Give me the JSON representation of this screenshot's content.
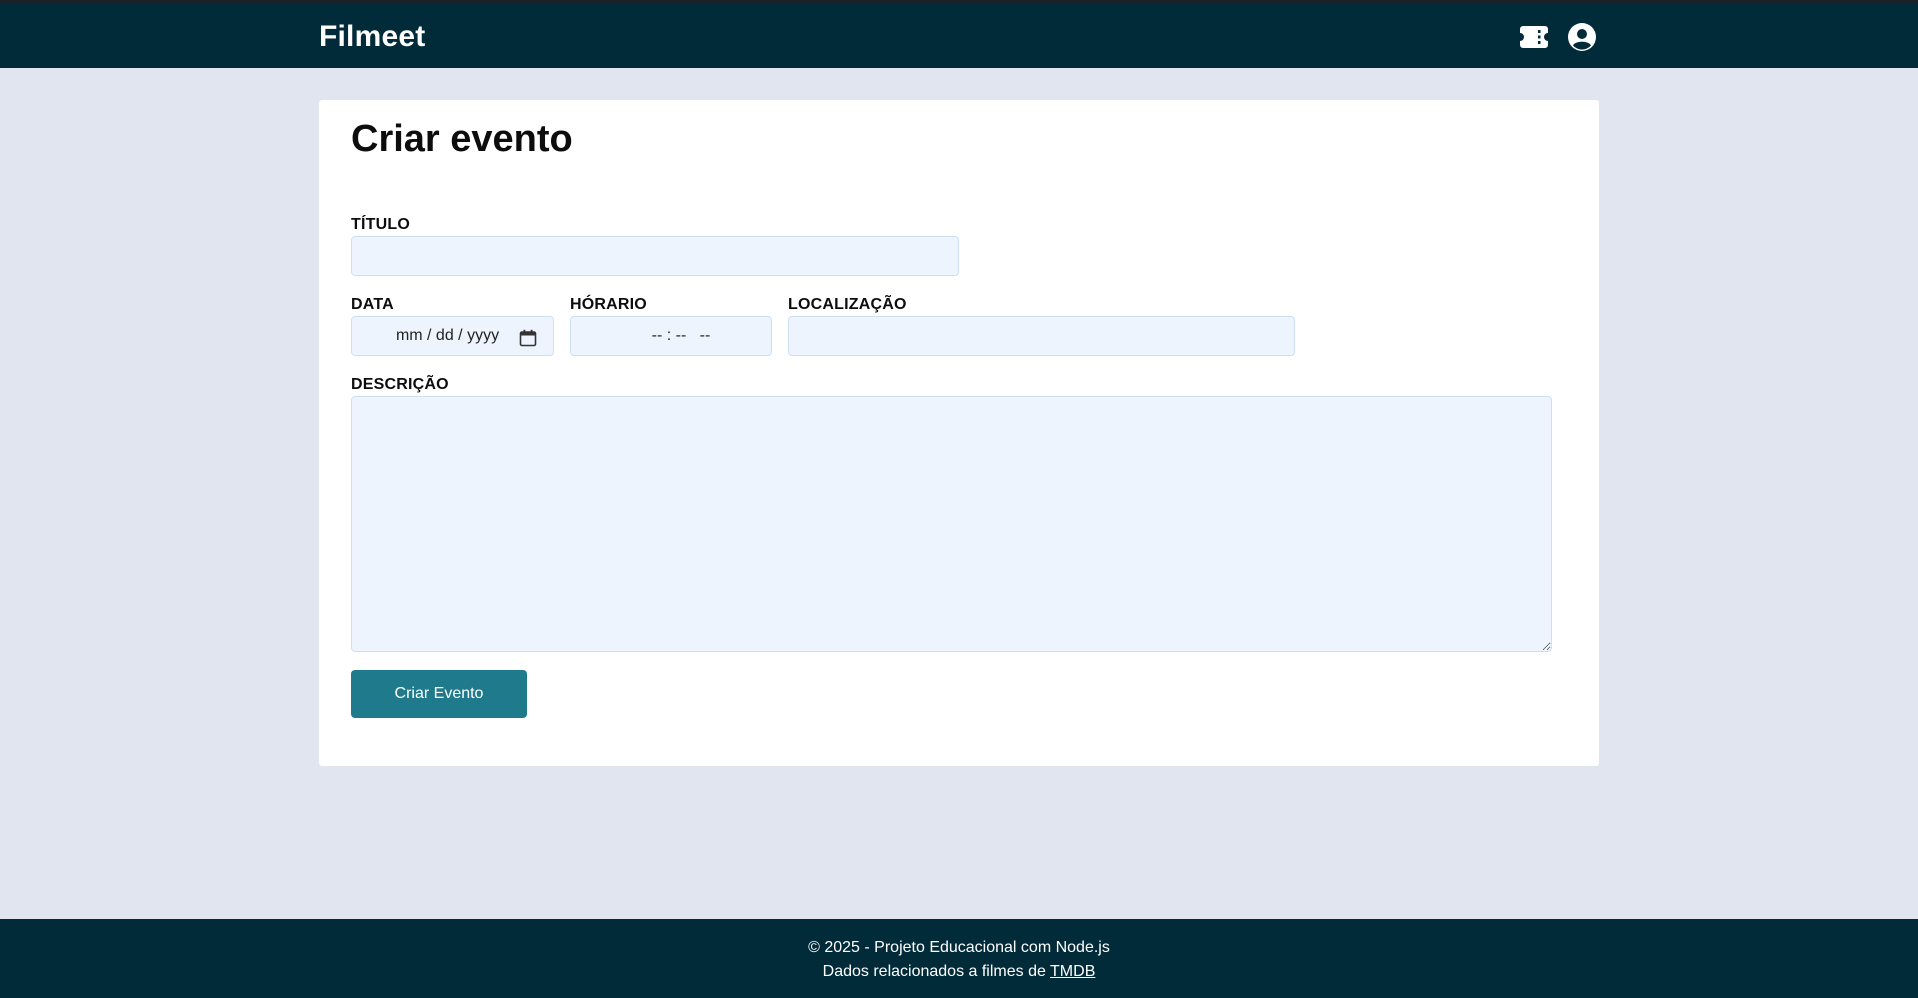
{
  "header": {
    "brand": "Filmeet",
    "icons": [
      "ticket-icon",
      "user-circle-icon"
    ]
  },
  "form": {
    "title": "Criar evento",
    "fields": {
      "titulo": {
        "label": "TÍTULO",
        "value": ""
      },
      "data": {
        "label": "DATA",
        "placeholder": "mm / dd / yyyy"
      },
      "horario": {
        "label": "HÓRARIO",
        "placeholder": "-- : --   --"
      },
      "localizacao": {
        "label": "LOCALIZAÇÃO",
        "value": ""
      },
      "descricao": {
        "label": "DESCRIÇÃO",
        "value": ""
      }
    },
    "submit_label": "Criar Evento"
  },
  "footer": {
    "line1": "© 2025 - Projeto Educacional com Node.js",
    "line2_prefix": "Dados relacionados a filmes de ",
    "line2_link": "TMDB"
  },
  "colors": {
    "header_bg": "#022b3a",
    "page_bg": "#e0e5f0",
    "input_bg": "#eef4fd",
    "accent": "#1f7a8c"
  }
}
